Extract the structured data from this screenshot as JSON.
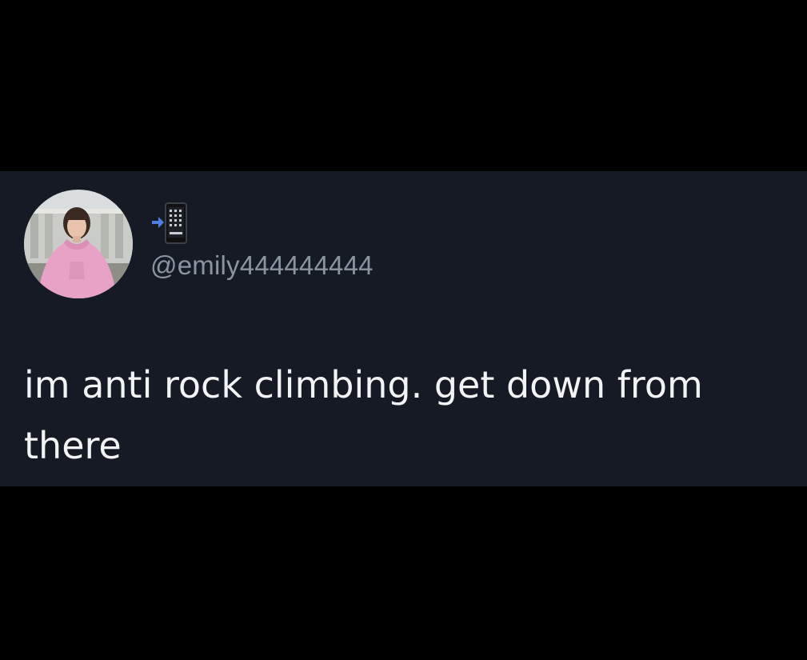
{
  "tweet": {
    "author": {
      "handle": "@emily444444444",
      "name_icon": "mobile-phone-with-arrow-icon",
      "avatar_icon": "profile-photo-avatar"
    },
    "text": "im anti rock climbing. get down from there"
  },
  "colors": {
    "page_background": "#000000",
    "card_background": "#161a25",
    "handle_text": "#8b95a1",
    "body_text": "#f2f3f5",
    "hoodie_pink": "#e7a2c6"
  }
}
